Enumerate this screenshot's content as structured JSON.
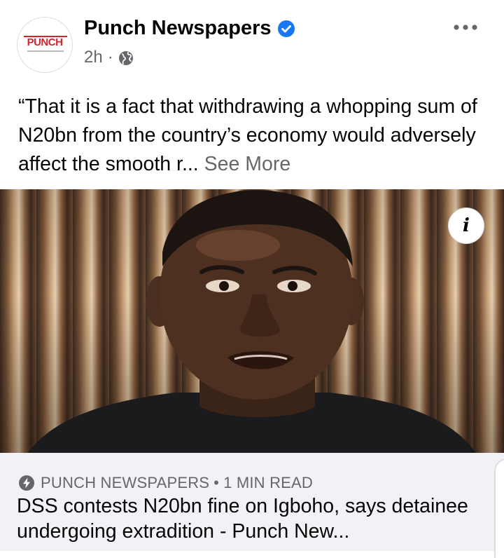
{
  "post": {
    "page_name": "Punch Newspapers",
    "time": "2h",
    "separator": "·",
    "caption": "“That it is a fact that withdrawing a whopping sum of N20bn from the country’s economy would adversely affect the smooth r...",
    "see_more": "See More",
    "avatar_logo_text": "PUNCH",
    "photo_description_icon": "info-icon"
  },
  "link": {
    "source": "PUNCH NEWSPAPERS",
    "separator": "•",
    "read_time": "1 MIN READ",
    "title": "DSS contests N20bn fine on Igboho, says detainee undergoing extradition - Punch New..."
  },
  "colors": {
    "verified": "#1877f2",
    "secondary_text": "#65676b",
    "link_background": "#f0f2f5",
    "brand_red": "#d4232a"
  },
  "icons": [
    "verified-badge-icon",
    "globe-icon",
    "more-options-icon",
    "info-icon",
    "bolt-icon"
  ]
}
